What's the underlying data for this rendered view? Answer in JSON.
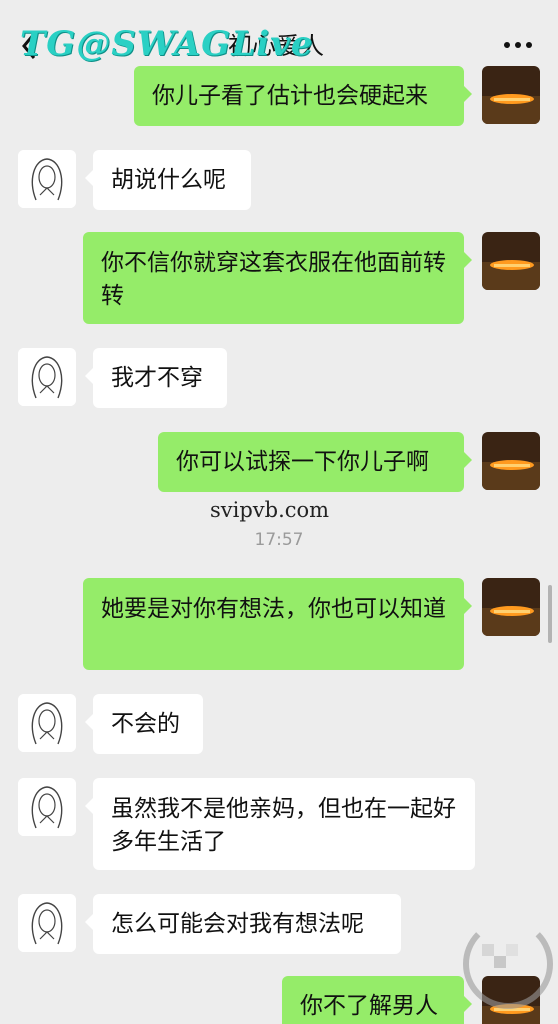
{
  "header": {
    "title": "初心爱人",
    "watermark": "TG@SWAGLive",
    "back_icon": "chevron-left-icon",
    "more_icon": "more-dots-icon"
  },
  "messages": [
    {
      "from": "me",
      "text": "你儿子看了估计也会硬起来"
    },
    {
      "from": "her",
      "text": "胡说什么呢"
    },
    {
      "from": "me",
      "text": "你不信你就穿这套衣服在他面前转转"
    },
    {
      "from": "her",
      "text": "我才不穿"
    },
    {
      "from": "me",
      "text": "你可以试探一下你儿子啊"
    },
    {
      "from": "me",
      "text": "她要是对你有想法，你也可以知道"
    },
    {
      "from": "her",
      "text": "不会的"
    },
    {
      "from": "her",
      "text": "虽然我不是他亲妈，但也在一起好多年生活了"
    },
    {
      "from": "her",
      "text": "怎么可能会对我有想法呢"
    },
    {
      "from": "me",
      "text": "你不了解男人"
    }
  ],
  "site_watermark": "svipvb.com",
  "timestamp": "17:57",
  "colors": {
    "background": "#ededed",
    "outgoing_bubble": "#95ec69",
    "incoming_bubble": "#ffffff",
    "watermark": "#2ad0c4"
  }
}
